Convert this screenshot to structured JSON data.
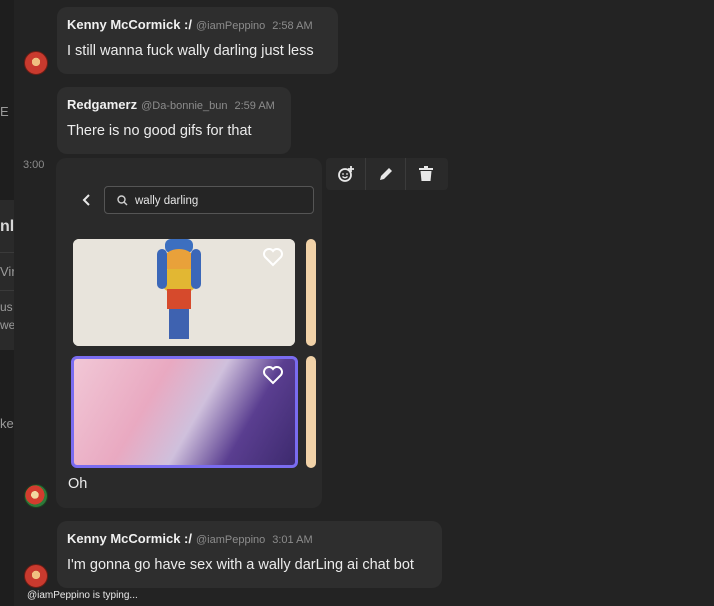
{
  "messages": [
    {
      "author": "Kenny McCormick :/",
      "handle": "@iamPeppino",
      "time": "2:58 AM",
      "text": "I still wanna fuck wally darling just less"
    },
    {
      "author": "Redgamerz",
      "handle": "@Da-bonnie_bun",
      "time": "2:59 AM",
      "text": "There is no good gifs for that"
    },
    {
      "author": "Kenny McCormick :/",
      "handle": "@iamPeppino",
      "time": "3:01 AM",
      "text": "I'm gonna go have sex with a wally darLing ai chat bot"
    }
  ],
  "picker_message": {
    "time": "3:00",
    "text": "Oh"
  },
  "gif_picker": {
    "search_value": "wally darling",
    "gifs": [
      {
        "icon": "heart-icon"
      },
      {
        "icon": "heart-icon"
      }
    ]
  },
  "toolbar": {
    "icons": [
      "add-reaction-icon",
      "pencil-icon",
      "trash-icon"
    ]
  },
  "typing_indicator": "@iamPeppino is typing...",
  "sidebar_fragments": [
    "E",
    "nl",
    "Vir",
    "us",
    "we",
    "ke"
  ],
  "colors": {
    "accent_selected": "#7a6cf0",
    "bubble": "#2e2e2e",
    "background": "#232323"
  }
}
